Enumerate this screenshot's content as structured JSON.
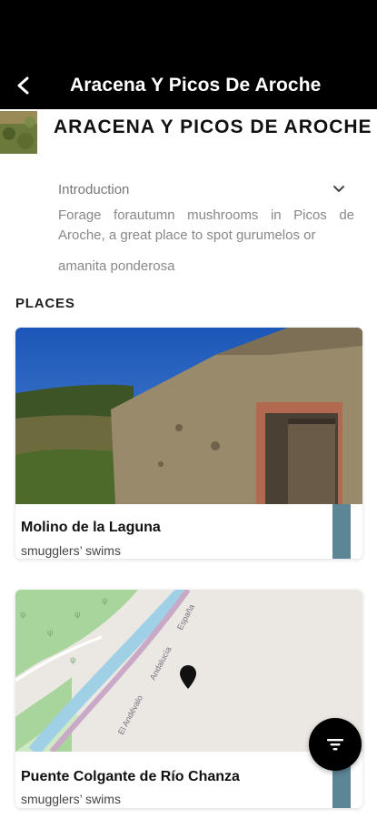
{
  "appbar": {
    "title": "Aracena Y Picos De Aroche",
    "back_icon": "arrow-back-icon"
  },
  "region": {
    "title": "ARACENA Y PICOS DE AROCHE"
  },
  "intro": {
    "label": "Introduction",
    "text_line1": "Forage forautumn mushrooms in Picos de Aroche, a great place to spot gurumelos or",
    "text_line2": "amanita ponderosa"
  },
  "places": {
    "heading": "PLACES",
    "items": [
      {
        "name": "Molino de la Laguna",
        "subtitle": "smugglers’ swims"
      },
      {
        "name": "Puente Colgante de Río Chanza",
        "subtitle": "smugglers’ swims"
      }
    ]
  },
  "map_labels": {
    "road1": "El Andévalo",
    "road2": "Andalucía",
    "road3": "España"
  },
  "fab": {
    "icon": "filter-icon"
  },
  "colors": {
    "bar_accent": "#5c8596",
    "header_bg": "#000000"
  }
}
